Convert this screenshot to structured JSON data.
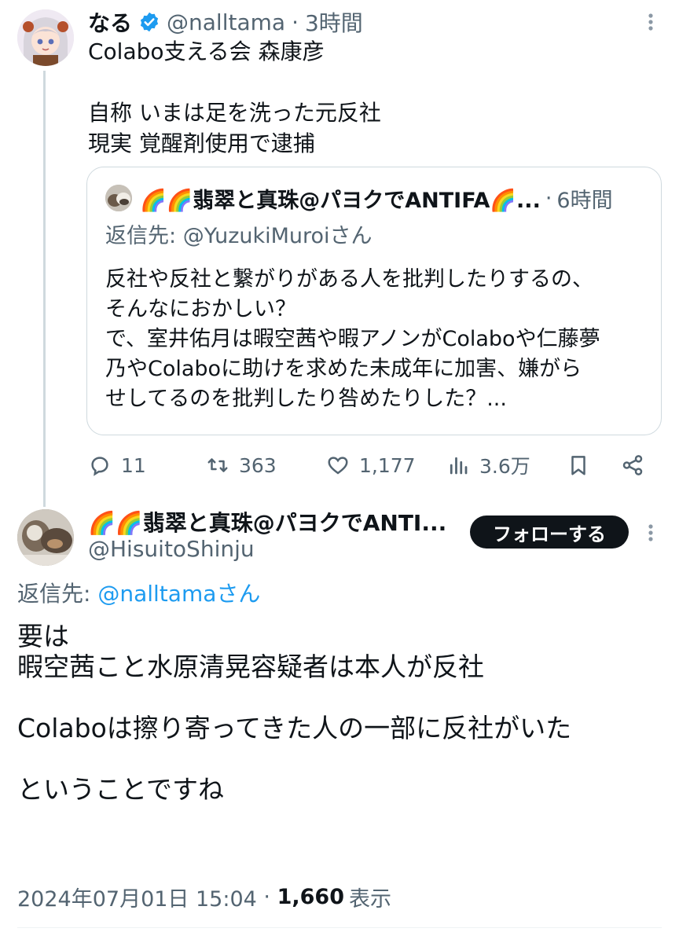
{
  "top_tweet": {
    "display_name": "なる",
    "handle": "@nalltama",
    "time_sep": "·",
    "time": "3時間",
    "text": "Colabo支える会 森康彦\n\n自称 いまは足を洗った元反社\n現実 覚醒剤使用で逮捕",
    "verified_icon": "verified-badge-icon",
    "more_icon": "more-vertical-icon"
  },
  "quote": {
    "display_name": "🌈🌈翡翠と真珠@パヨクでANTIFA🌈...",
    "time_sep": "·",
    "time": "6時間",
    "reply_prefix": "返信先: ",
    "reply_handle": "@YuzukiMuroiさん",
    "text": "反社や反社と繋がりがある人を批判したりするの、\nそんなにおかしい？\nで、室井佑月は暇空茜や暇アノンがColaboや仁藤夢\n乃やColaboに助けを求めた未成年に加害、嫌がら\nせしてるのを批判したり咎めたりした？..."
  },
  "actions": {
    "reply_count": "11",
    "retweet_count": "363",
    "like_count": "1,177",
    "view_count": "3.6万",
    "icons": [
      "reply-icon",
      "retweet-icon",
      "like-icon",
      "views-icon",
      "bookmark-icon",
      "share-icon"
    ]
  },
  "reply_tweet": {
    "display_name": "🌈🌈翡翠と真珠@パヨクでANTI...",
    "handle": "@HisuitoShinju",
    "follow_label": "フォローする",
    "reply_prefix": "返信先: ",
    "reply_handle": "@nalltamaさん",
    "text": "要は\n暇空茜こと水原清晃容疑者は本人が反社\n\nColaboは擦り寄ってきた人の一部に反社がいた\n\nということですね",
    "timestamp": "2024年07月01日 15:04",
    "sep": " · ",
    "views": "1,660",
    "views_label": "表示"
  },
  "colors": {
    "text_primary": "#0f1419",
    "text_secondary": "#536471",
    "link": "#1d9bf0",
    "verified": "#1d9bf0",
    "border": "#cfd9de"
  }
}
